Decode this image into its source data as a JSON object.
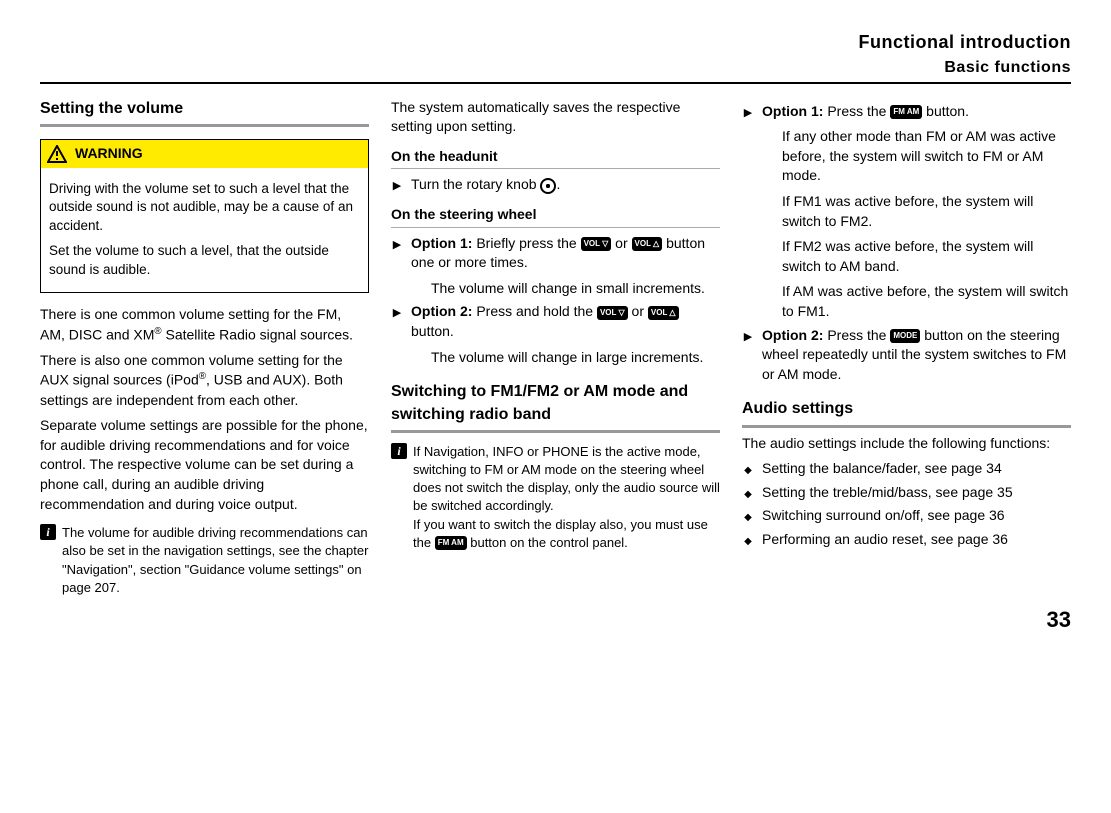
{
  "header": {
    "line1": "Functional introduction",
    "line2": "Basic functions"
  },
  "col1": {
    "h_setting_volume": "Setting the volume",
    "warn_label": "WARNING",
    "warn_p1": "Driving with the volume set to such a level that the outside sound is not audible, may be a cause of an accident.",
    "warn_p2": "Set the volume to such a level, that the outside sound is audible.",
    "p1a": "There is one common volume setting for the FM, AM, DISC and XM",
    "p1b": " Satellite Radio signal sources.",
    "p2a": "There is also one common volume setting for the AUX signal sources (iPod",
    "p2b": ", USB and AUX). Both settings are independent from each other.",
    "p3": "Separate volume settings are possible for the phone, for audible driving recommendations and for voice control. The respective volume can be set during a phone call, during an audible driving recommendation and during voice output.",
    "note1": "The volume for audible driving recommendations can also be set in the navigation settings, see the chapter \"Navigation\", section \"Guidance volume settings\" on page 207."
  },
  "col2": {
    "p_intro": "The system automatically saves the respective setting upon setting.",
    "h_headunit": "On the headunit",
    "li_turn_knob": "Turn the rotary knob ",
    "h_steering": "On the steering wheel",
    "opt1_label": "Option 1:",
    "opt1_text_a": " Briefly press the ",
    "opt1_text_b": " or ",
    "opt1_text_c": " button one or more times.",
    "opt1_follow": "The volume will change in small increments.",
    "opt2_label": "Option 2:",
    "opt2_text_a": " Press and hold the ",
    "opt2_text_b": " or ",
    "opt2_text_c": " button.",
    "opt2_follow": "The volume will change in large increments.",
    "h_switching": "Switching to FM1/FM2 or AM mode and switching radio band",
    "note2a": "If Navigation, INFO or PHONE is the active mode, switching to FM or AM mode on the steering wheel does not switch the display, only the audio source will be switched accordingly.",
    "note2b_a": "If you want to switch the display also, you must use the ",
    "note2b_b": " button on the control panel."
  },
  "col3": {
    "opt1_label": "Option 1:",
    "opt1_a": " Press the ",
    "opt1_b": " button.",
    "opt1_p1": "If any other mode than FM or AM was active before, the system will switch to FM or AM mode.",
    "opt1_p2": "If FM1 was active before, the system will switch to FM2.",
    "opt1_p3": "If FM2 was active before, the system will switch to AM band.",
    "opt1_p4": "If AM was active before, the system will switch to FM1.",
    "opt2_label": "Option 2:",
    "opt2_a": " Press the ",
    "opt2_b": " button on the steering wheel repeatedly until the system switches to FM or AM mode.",
    "h_audio": "Audio settings",
    "audio_intro": "The audio settings include the following functions:",
    "li1": "Setting the balance/fader, see page 34",
    "li2": "Setting the treble/mid/bass, see page 35",
    "li3": "Switching surround on/off, see page 36",
    "li4": "Performing an audio reset, see page 36"
  },
  "keys": {
    "fm_am": "FM AM",
    "vol_down": "VOL ▽",
    "vol_up": "VOL △",
    "mode": "MODE"
  },
  "page_number": "33"
}
